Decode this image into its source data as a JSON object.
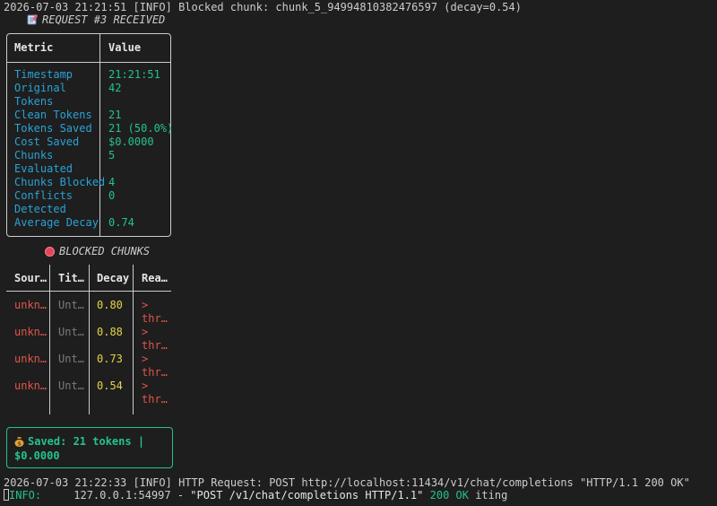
{
  "log_top": "2026-07-03 21:21:51 [INFO] Blocked chunk: chunk_5_94994810382476597 (decay=0.54)",
  "request_title": "REQUEST #3 RECEIVED",
  "metrics_table": {
    "headers": [
      "Metric",
      "Value"
    ],
    "rows": [
      {
        "metric": [
          "Timestamp"
        ],
        "value": "21:21:51"
      },
      {
        "metric": [
          "Original",
          "Tokens"
        ],
        "value": "42"
      },
      {
        "metric": [
          "Clean Tokens"
        ],
        "value": "21"
      },
      {
        "metric": [
          "Tokens Saved"
        ],
        "value": "21 (50.0%)"
      },
      {
        "metric": [
          "Cost Saved"
        ],
        "value": "$0.0000"
      },
      {
        "metric": [
          "Chunks",
          "Evaluated"
        ],
        "value": "5"
      },
      {
        "metric": [
          "Chunks Blocked"
        ],
        "value": "4"
      },
      {
        "metric": [
          "Conflicts",
          "Detected"
        ],
        "value": "0"
      },
      {
        "metric": [
          "Average Decay"
        ],
        "value": "0.74"
      }
    ]
  },
  "blocked_title": "BLOCKED CHUNKS",
  "blocked_table": {
    "headers": [
      "Sour…",
      "Tit…",
      "Decay",
      "Rea…"
    ],
    "rows": [
      {
        "source": "unkn…",
        "title": "Unt…",
        "decay": "0.80",
        "reason": [
          ">",
          "thr…"
        ]
      },
      {
        "source": "unkn…",
        "title": "Unt…",
        "decay": "0.88",
        "reason": [
          ">",
          "thr…"
        ]
      },
      {
        "source": "unkn…",
        "title": "Unt…",
        "decay": "0.73",
        "reason": [
          ">",
          "thr…"
        ]
      },
      {
        "source": "unkn…",
        "title": "Unt…",
        "decay": "0.54",
        "reason": [
          ">",
          "thr…"
        ]
      }
    ]
  },
  "saved_panel": {
    "line1": "Saved: 21 tokens |",
    "line2": "$0.0000"
  },
  "log_bottom": "2026-07-03 21:22:33 [INFO] HTTP Request: POST http://localhost:11434/v1/chat/completions \"HTTP/1.1 200 OK\"",
  "info_line": {
    "prefix": "INFO:",
    "address": "     127.0.0.1:54997 - ",
    "request": "\"POST /v1/chat/completions HTTP/1.1\"",
    "status": " 200 OK",
    "trailing": " iting"
  },
  "colors": {
    "background": "#1e1e1e",
    "metric_label": "#29a3d6",
    "metric_value": "#23c38c",
    "decay": "#e5d44a",
    "source_reason": "#e0554b",
    "dim": "#7a7a7a",
    "saved_border": "#23c38c"
  }
}
